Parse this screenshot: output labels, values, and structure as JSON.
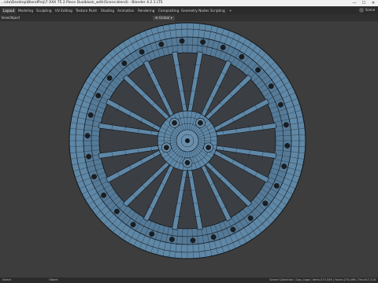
{
  "window": {
    "title": "...ista\\Desktop\\BlendProj\\7 XXX 75 2 Piece Dualblock_with(Scene.blend) - Blender 4.2.1 LTS",
    "minimize": "—",
    "maximize": "☐",
    "close": "✕"
  },
  "menubar": {
    "tabs": [
      "Layout",
      "Modeling",
      "Sculpting",
      "UV Editing",
      "Texture Paint",
      "Shading",
      "Animation",
      "Rendering",
      "Compositing",
      "Geometry Nodes",
      "Scripting",
      "+"
    ],
    "active_tab": 0,
    "user_label": "Scene"
  },
  "header": {
    "mode": "View",
    "object_menu": "Object",
    "orientation": "Global",
    "orientation_icon": "globe-icon"
  },
  "status": {
    "left": "Select",
    "mid": "Object",
    "right": "Scene Collection | Cap_Logo | Verts:273,549 | Faces:270,496 | Tris:547,216"
  },
  "colors": {
    "wheel": "#5f87a6",
    "wire": "#11161b",
    "background": "#3d3d3d",
    "active_tab": "#3d3d3d"
  }
}
